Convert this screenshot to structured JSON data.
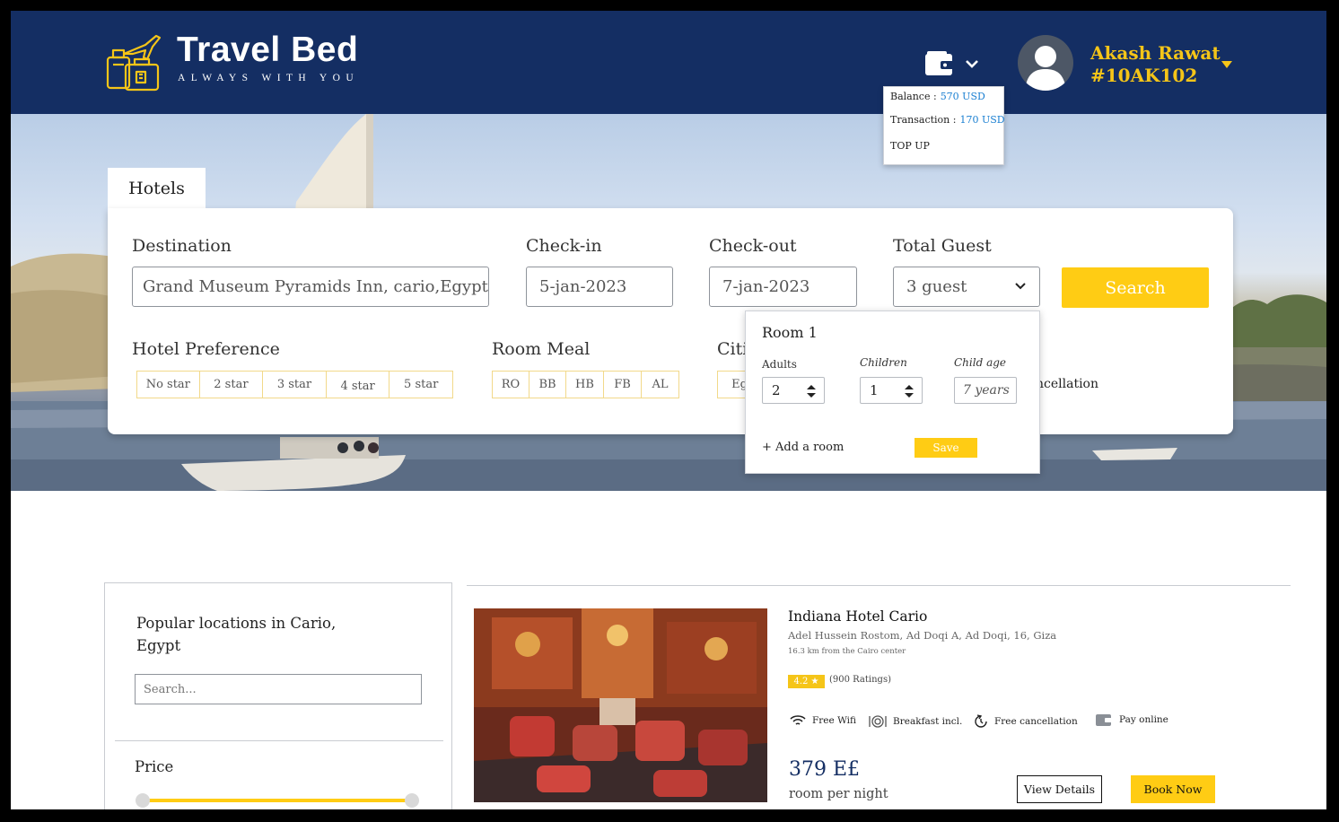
{
  "header": {
    "brand": "Travel Bed",
    "tagline": "ALWAYS WITH YOU",
    "user_name": "Akash Rawat",
    "user_id": "#10AK102"
  },
  "wallet_menu": {
    "balance_label": "Balance :",
    "balance_value": "570 USD",
    "transaction_label": "Transaction :",
    "transaction_value": "170 USD",
    "top_up": "TOP UP"
  },
  "search": {
    "tab": "Hotels",
    "destination_label": "Destination",
    "destination_value": "Grand Museum Pyramids Inn, cario,Egypt",
    "checkin_label": "Check-in",
    "checkin_value": "5-jan-2023",
    "checkout_label": "Check-out",
    "checkout_value": "7-jan-2023",
    "guest_label": "Total Guest",
    "guest_value": "3 guest",
    "search_button": "Search",
    "hotel_pref_label": "Hotel Preference",
    "hotel_pref_options": [
      "No star",
      "2 star",
      "3 star",
      "4 star",
      "5 star"
    ],
    "room_meal_label": "Room Meal",
    "room_meal_options": [
      "RO",
      "BB",
      "HB",
      "FB",
      "AL"
    ],
    "cities_label_partial": "Citi",
    "cities_option_partial": "Eg",
    "cancellation_partial": "ncellation"
  },
  "guest_menu": {
    "room_title": "Room 1",
    "adults_label": "Adults",
    "adults_value": "2",
    "children_label": "Children",
    "children_value": "1",
    "child_age_label": "Child age",
    "child_age_value": "7 years",
    "add_room": "+ Add a room",
    "save": "Save"
  },
  "sidebar": {
    "title": "Popular locations in Cario, Egypt",
    "search_placeholder": "Search...",
    "price_label": "Price"
  },
  "hotel": {
    "name": "Indiana Hotel Cario",
    "address": "Adel Hussein Rostom, Ad Doqi A, Ad Doqi, 16, Giza",
    "distance": "16.3 km from the Cairo center",
    "rating": "4.2 ★",
    "ratings_count": "(900 Ratings)",
    "amenities": [
      "Free Wifi",
      "Breakfast incl.",
      "Free cancellation",
      "Pay online"
    ],
    "price": "379 E£",
    "price_unit": "room per night",
    "view_button": "View Details",
    "book_button": "Book Now"
  },
  "colors": {
    "header_bg": "#142e63",
    "accent": "#ffcc14",
    "user_text": "#f5c518",
    "link_blue": "#1a7fd1"
  }
}
